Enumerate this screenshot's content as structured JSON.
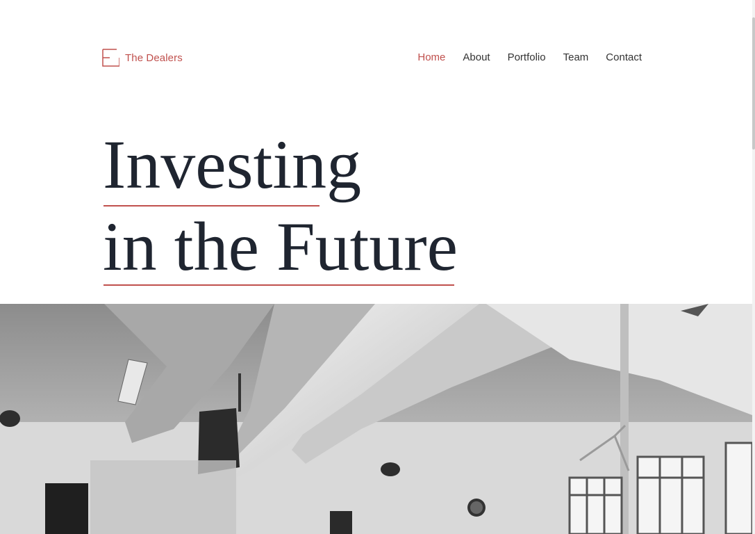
{
  "brand": {
    "name": "The Dealers",
    "accent": "#c0504d"
  },
  "nav": {
    "items": [
      {
        "label": "Home",
        "active": true
      },
      {
        "label": "About",
        "active": false
      },
      {
        "label": "Portfolio",
        "active": false
      },
      {
        "label": "Team",
        "active": false
      },
      {
        "label": "Contact",
        "active": false
      }
    ]
  },
  "hero": {
    "line1": "Investing",
    "line2": "in the Future",
    "text_color": "#1f2530"
  },
  "photo": {
    "icon": "office-photo-grayscale"
  }
}
